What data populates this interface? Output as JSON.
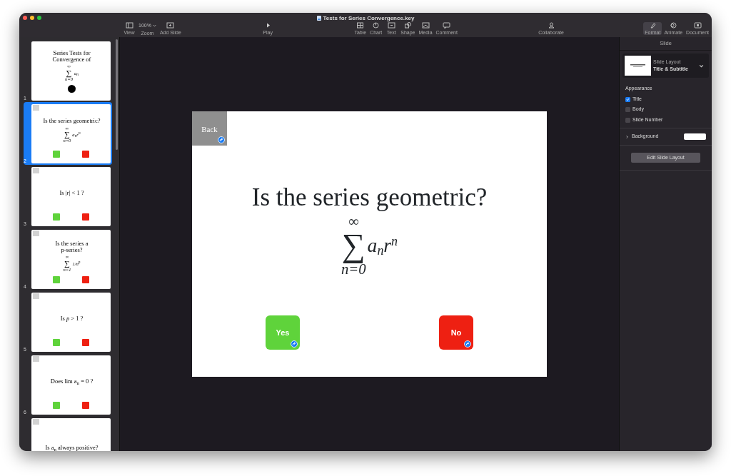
{
  "window": {
    "title": "Tests for Series Convergence.key"
  },
  "toolbar": {
    "items": [
      {
        "label": "View",
        "kind": "view",
        "selected": false
      },
      {
        "label": "Zoom",
        "kind": "zoom",
        "value": "100%",
        "selected": false
      },
      {
        "label": "Add Slide",
        "kind": "add",
        "selected": false
      },
      {
        "label": "Play",
        "kind": "play",
        "selected": false
      },
      {
        "label": "Table",
        "kind": "table",
        "selected": false
      },
      {
        "label": "Chart",
        "kind": "chart",
        "selected": false
      },
      {
        "label": "Text",
        "kind": "text",
        "selected": false
      },
      {
        "label": "Shape",
        "kind": "shape",
        "selected": false
      },
      {
        "label": "Media",
        "kind": "media",
        "selected": false
      },
      {
        "label": "Comment",
        "kind": "comment",
        "selected": false
      },
      {
        "label": "Collaborate",
        "kind": "collaborate",
        "selected": false
      },
      {
        "label": "Format",
        "kind": "format",
        "selected": true
      },
      {
        "label": "Animate",
        "kind": "animate",
        "selected": false
      },
      {
        "label": "Document",
        "kind": "document",
        "selected": false
      }
    ]
  },
  "slides": [
    {
      "number": "1",
      "selected": false,
      "kind": "start",
      "lines": [
        "Series Tests for",
        "Convergence of"
      ],
      "formula": {
        "upper": "∞",
        "symbol": "∑",
        "lower": "n=0",
        "body": "a$_{n}$"
      }
    },
    {
      "number": "2",
      "selected": true,
      "kind": "question",
      "answers": true,
      "lines": [
        "Is the series geometric?"
      ],
      "formula": {
        "upper": "∞",
        "symbol": "∑",
        "lower": "n=0",
        "body": "a$_{n}$r$^{n}$"
      }
    },
    {
      "number": "3",
      "selected": false,
      "kind": "question",
      "answers": true,
      "lines": [
        "Is |*r*| < 1 ?"
      ]
    },
    {
      "number": "4",
      "selected": false,
      "kind": "question",
      "answers": true,
      "lines": [
        "Is the series a",
        "p-series?"
      ],
      "formula": {
        "upper": "∞",
        "symbol": "∑",
        "lower": "n=1",
        "body": "1/n$^{p}$"
      }
    },
    {
      "number": "5",
      "selected": false,
      "kind": "question",
      "answers": true,
      "lines": [
        "Is *p* > 1 ?"
      ]
    },
    {
      "number": "6",
      "selected": false,
      "kind": "question",
      "answers": true,
      "lines": [
        "Does lim a$_{n}$ = 0 ?"
      ]
    },
    {
      "selected": false,
      "kind": "question",
      "answers": false,
      "lines": [
        "Is a$_{n}$ always positive?"
      ]
    }
  ],
  "slide": {
    "back_label": "Back",
    "title": "Is the series geometric?",
    "formula": {
      "upper": "∞",
      "symbol": "∑",
      "lower": "n=0",
      "body": "a$_{n}$r$^{n}$"
    },
    "buttons": [
      {
        "label": "Yes",
        "color": "#5fd33b"
      },
      {
        "label": "No",
        "color": "#ee2012"
      }
    ]
  },
  "inspector": {
    "header": "Slide",
    "layout_label": "Slide Layout",
    "layout_value": "Title & Subtitle",
    "appearance_heading": "Appearance",
    "options": [
      {
        "label": "Title",
        "checked": true
      },
      {
        "label": "Body",
        "checked": false
      },
      {
        "label": "Slide Number",
        "checked": false
      }
    ],
    "background_label": "Background",
    "edit_button": "Edit Slide Layout"
  }
}
